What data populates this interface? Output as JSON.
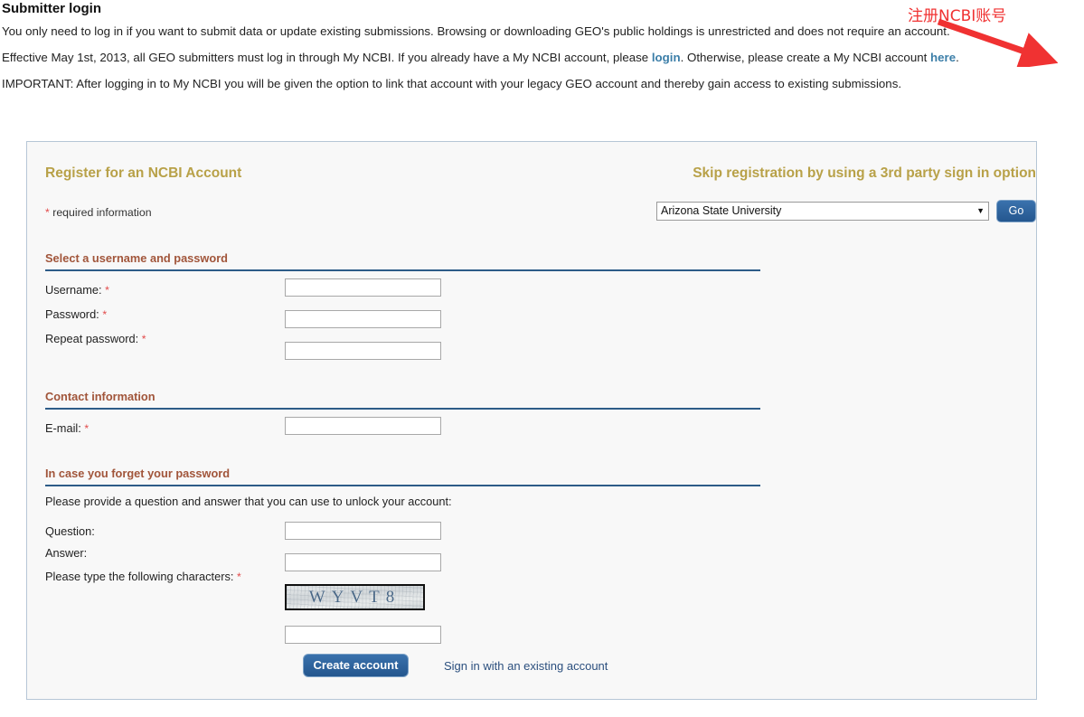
{
  "page": {
    "title": "Submitter login",
    "intro_lines": [
      {
        "segments": [
          {
            "text": "You only need to log in if you want to submit data or update existing submissions. Browsing or downloading GEO's public holdings is unrestricted and does not require an account.",
            "link": false
          }
        ]
      },
      {
        "segments": [
          {
            "text": "Effective May 1st, 2013, all GEO submitters must log in through My NCBI. If you already have a My NCBI account, please ",
            "link": false
          },
          {
            "text": "login",
            "link": true
          },
          {
            "text": ". Otherwise, please create a My NCBI account ",
            "link": false
          },
          {
            "text": "here",
            "link": true
          },
          {
            "text": ".",
            "link": false
          }
        ]
      },
      {
        "segments": [
          {
            "text": "IMPORTANT: After logging in to My NCBI you will be given the option to link that account with your legacy GEO account and thereby gain access to existing submissions.",
            "link": false
          }
        ]
      }
    ]
  },
  "annotation": {
    "text": "注册NCBI账号",
    "color": "#f03232",
    "arrow_name": "red-arrow-to-here-link"
  },
  "register": {
    "title": "Register for an NCBI Account",
    "required_note": "required information",
    "required_star": "*",
    "thirdparty": {
      "title": "Skip registration by using a 3rd party sign in option",
      "selected_option": "Arizona State University",
      "dropdown_arrow": "▼",
      "go_label": "Go"
    },
    "sections": [
      {
        "label": "Select a username and password"
      },
      {
        "label": "Contact information"
      },
      {
        "label": "In case you forget your password"
      }
    ],
    "fields": {
      "username_label": "Username:",
      "username_value": "",
      "password_label": "Password:",
      "password_value": "",
      "repeat_password_label": "Repeat password:",
      "repeat_password_value": "",
      "email_label": "E-mail:",
      "email_value": "",
      "question_label": "Question:",
      "question_value": "",
      "answer_label": "Answer:",
      "answer_value": "",
      "captcha_label": "Please type the following characters:",
      "captcha_value": ""
    },
    "recovery_helper": "Please provide a question and answer that you can use to unlock your account:",
    "captcha_text": "WYVT8",
    "create_account_label": "Create account",
    "signin_link_label": "Sign in with an existing account"
  },
  "colors": {
    "panel_title": "#b8a148",
    "section_header": "#a1553a",
    "section_rule": "#2d5c88",
    "link": "#3b7ea8",
    "button": "#2d5c88",
    "required_star": "#e24a4a"
  }
}
